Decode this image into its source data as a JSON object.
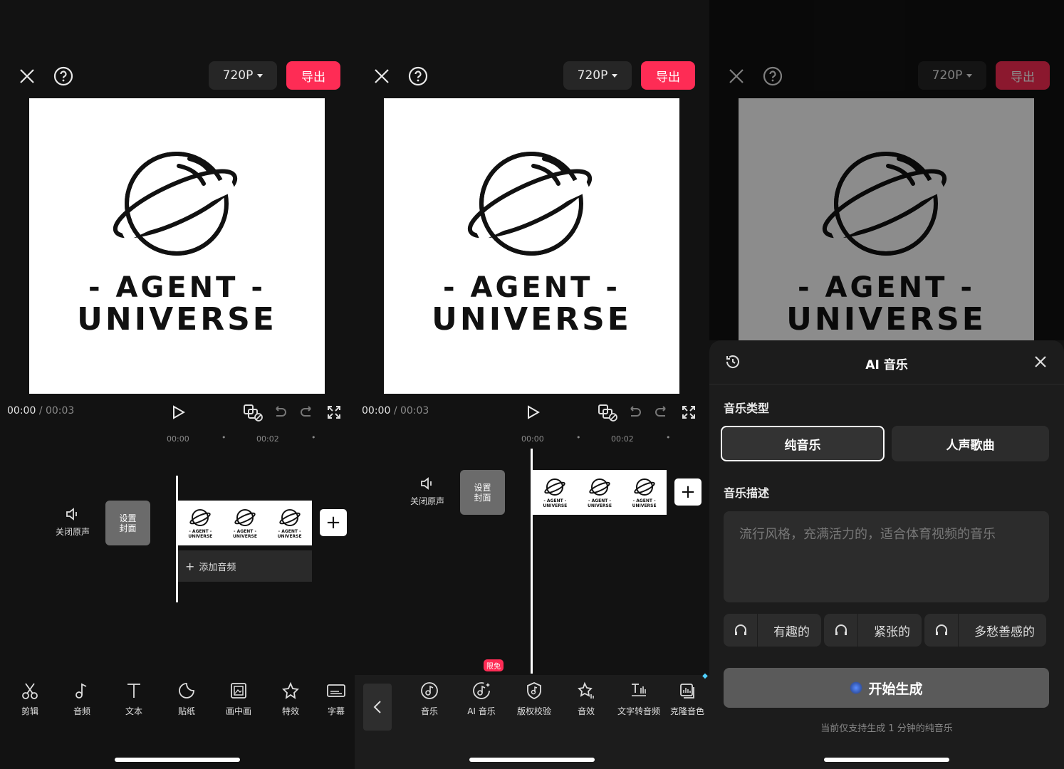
{
  "panels": [
    {
      "topbar": {
        "resolution": "720P",
        "export_label": "导出"
      },
      "preview": {
        "line1": "- AGENT -",
        "line2": "UNIVERSE"
      },
      "player": {
        "current": "00:00",
        "separator": "/",
        "duration": "00:03"
      },
      "ruler": {
        "t0": "00:00",
        "t1": "00:02"
      },
      "track": {
        "mute_label": "关闭原声",
        "cover_label": "设置\n封面",
        "add_audio_label": "添加音频"
      },
      "toolbar": [
        "剪辑",
        "音频",
        "文本",
        "贴纸",
        "画中画",
        "特效",
        "字幕"
      ]
    },
    {
      "topbar": {
        "resolution": "720P",
        "export_label": "导出"
      },
      "preview": {
        "line1": "- AGENT -",
        "line2": "UNIVERSE"
      },
      "player": {
        "current": "00:00",
        "separator": "/",
        "duration": "00:03"
      },
      "ruler": {
        "t0": "00:00",
        "t1": "00:02"
      },
      "track": {
        "mute_label": "关闭原声",
        "cover_label": "设置\n封面"
      },
      "toolbar": [
        "音乐",
        "AI 音乐",
        "版权校验",
        "音效",
        "文字转音频",
        "克隆音色"
      ],
      "badge": "限免"
    },
    {
      "topbar": {
        "resolution": "720P",
        "export_label": "导出"
      },
      "preview": {
        "line1": "- AGENT -",
        "line2": "UNIVERSE"
      },
      "sheet": {
        "title": "AI 音乐",
        "type_label": "音乐类型",
        "types": [
          "纯音乐",
          "人声歌曲"
        ],
        "selected_type": "纯音乐",
        "desc_label": "音乐描述",
        "desc_placeholder": "流行风格，充满活力的，适合体育视频的音乐",
        "moods": [
          "有趣的",
          "紧张的",
          "多愁善感的"
        ],
        "generate_label": "开始生成",
        "note": "当前仅支持生成 1 分钟的纯音乐"
      }
    }
  ],
  "thumb_text": {
    "a": "- AGENT -",
    "b": "UNIVERSE"
  }
}
